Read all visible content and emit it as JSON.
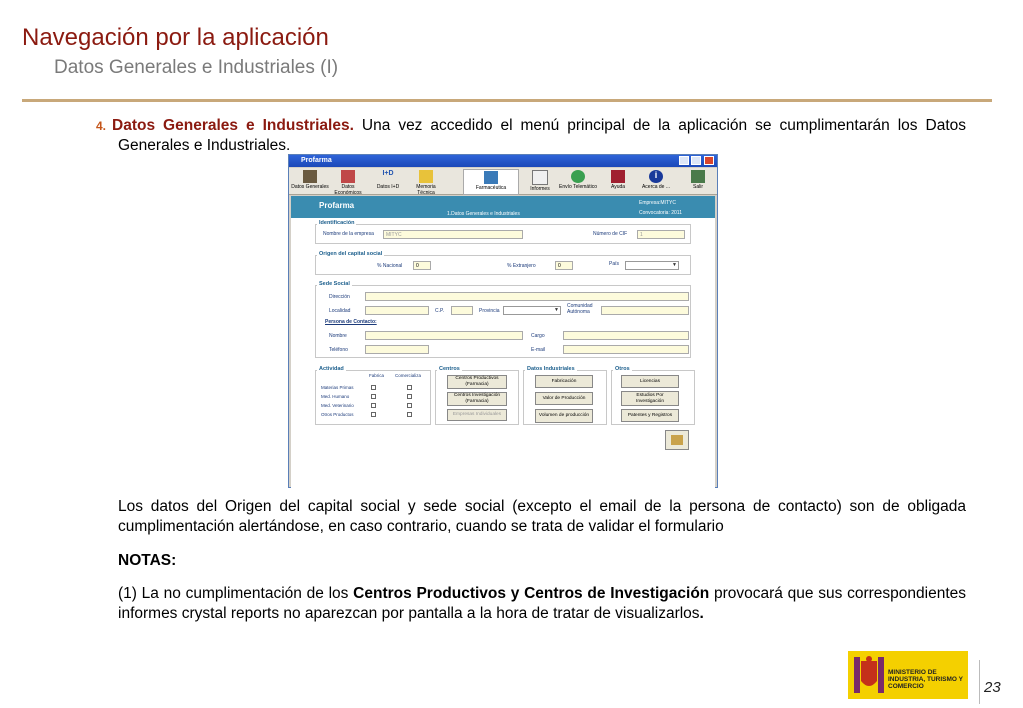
{
  "title": "Navegación por la aplicación",
  "subtitle": "Datos Generales e Industriales (I)",
  "step": {
    "number": "4.",
    "heading": "Datos Generales e Industriales.",
    "text": " Una vez accedido el menú principal de la aplicación se cumplimentarán los Datos Generales e Industriales."
  },
  "para2": "Los datos del Origen del capital social y sede social (excepto el email de la persona de contacto) son de obligada cumplimentación alertándose, en caso contrario, cuando se trata de validar el formulario",
  "notes_label": "NOTAS:",
  "note1": {
    "pre": "(1) La no cumplimentación de los ",
    "bold": "Centros Productivos y Centros de Investigación",
    "post": " provocará que sus correspondientes informes crystal reports no aparezcan por pantalla a la hora de tratar de visualizarlos",
    "end": "."
  },
  "window": {
    "title": "Profarma",
    "toolbar": [
      "Datos Generales",
      "Datos Económicos",
      "Datos I+D",
      "Memoria Técnica",
      "Farmacéutica",
      "Informes",
      "Envío Telemático",
      "Ayuda",
      "Acerca de ...",
      "Salir"
    ],
    "app_name": "Profarma",
    "company": "Empresa:MITYC",
    "convocatoria": "Convocatoria: 2011",
    "section_title": "1.Datos Generales e Industriales",
    "identificacion": {
      "label": "Identificación",
      "nombre_label": "Nombre de la empresa",
      "nombre_value": "MITYC",
      "cif_label": "Número de CIF",
      "cif_value": "1"
    },
    "capital": {
      "label": "Origen del capital social",
      "nacional_label": "% Nacional",
      "nacional_value": "0",
      "extranjero_label": "% Extranjero",
      "extranjero_value": "0",
      "pais_label": "País"
    },
    "sede": {
      "label": "Sede Social",
      "direccion": "Dirección",
      "localidad": "Localidad",
      "cp": "C.P.",
      "provincia": "Provincia",
      "comunidad": "Comunidad Autónoma",
      "contacto": "Persona de Contacto:",
      "nombre": "Nombre",
      "cargo": "Cargo",
      "telefono": "Teléfono",
      "email": "E-mail"
    },
    "actividad": {
      "label": "Actividad",
      "col1": "Fabrica",
      "col2": "Comercializa",
      "rows": [
        "Materias Primas",
        "Med. Humano",
        "Med. Veterinario",
        "Otros Productos"
      ]
    },
    "centros": {
      "label": "Centros",
      "b1": "Centros Productivos (Farmacia)",
      "b2": "Centros Investigación (Farmacia)",
      "b3": "Empresas Individuales"
    },
    "industriales": {
      "label": "Datos Industriales",
      "b1": "Fabricación",
      "b2": "Valor de Producción",
      "b3": "Volumen de producción"
    },
    "otros": {
      "label": "Otros",
      "b1": "Licencias",
      "b2": "Estudios Por Investigación",
      "b3": "Patentes y Registros"
    }
  },
  "ministry": "MINISTERIO DE INDUSTRIA, TURISMO Y COMERCIO",
  "page_number": "23",
  "colors": {
    "title": "#8b1a10",
    "accent": "#c8a87a",
    "header": "#3a8cb0"
  }
}
